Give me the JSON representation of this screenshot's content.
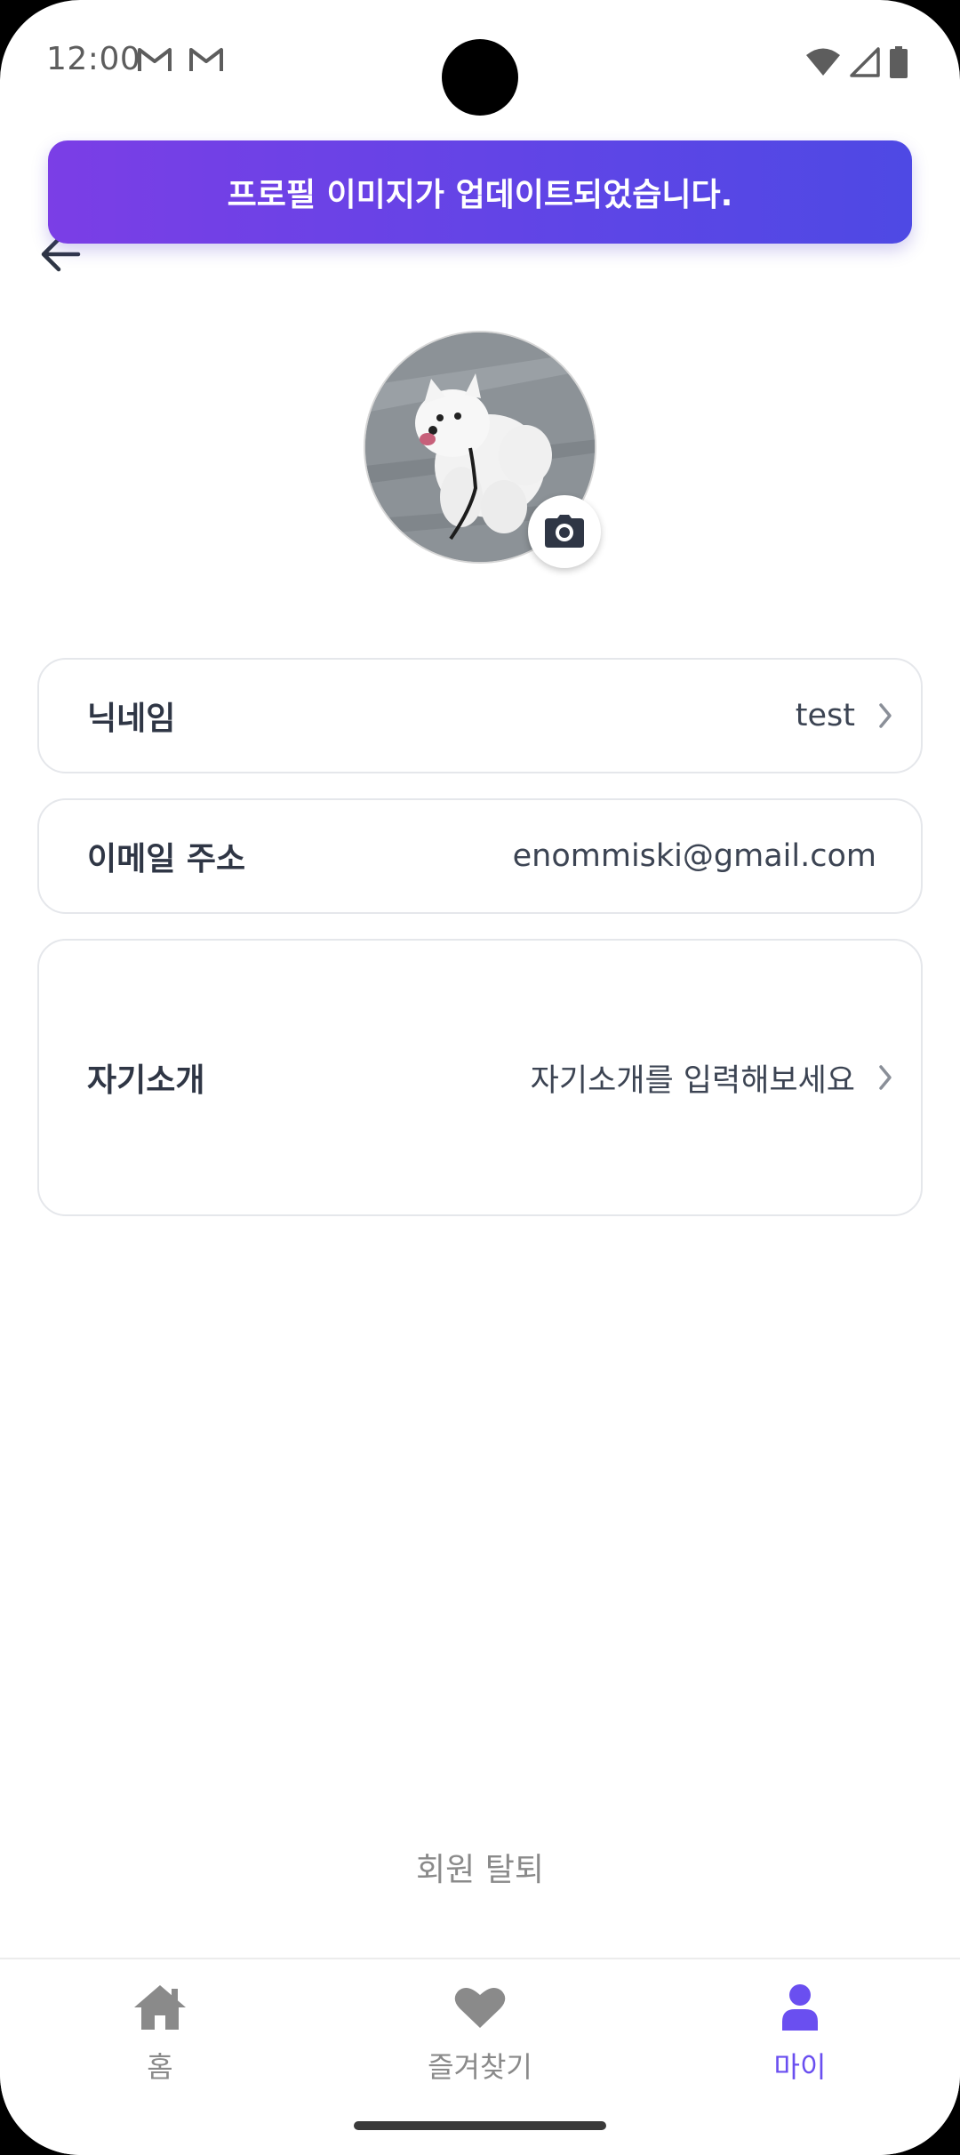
{
  "status_bar": {
    "time": "12:00"
  },
  "toast": {
    "message": "프로필 이미지가 업데이트되었습니다."
  },
  "profile": {
    "nickname_label": "닉네임",
    "nickname_value": "test",
    "email_label": "이메일 주소",
    "email_value": "enommiski@gmail.com",
    "bio_label": "자기소개",
    "bio_placeholder": "자기소개를 입력해보세요"
  },
  "withdraw": {
    "label": "회원 탈퇴"
  },
  "bottom_nav": {
    "items": [
      {
        "label": "홈",
        "icon": "home-icon",
        "active": false
      },
      {
        "label": "즐겨찾기",
        "icon": "heart-icon",
        "active": false
      },
      {
        "label": "마이",
        "icon": "user-icon",
        "active": true
      }
    ]
  },
  "colors": {
    "accent": "#6a4ff0",
    "toast_gradient_start": "#7b3ee6",
    "toast_gradient_end": "#4e49e4",
    "inactive": "#8a8a8a"
  }
}
